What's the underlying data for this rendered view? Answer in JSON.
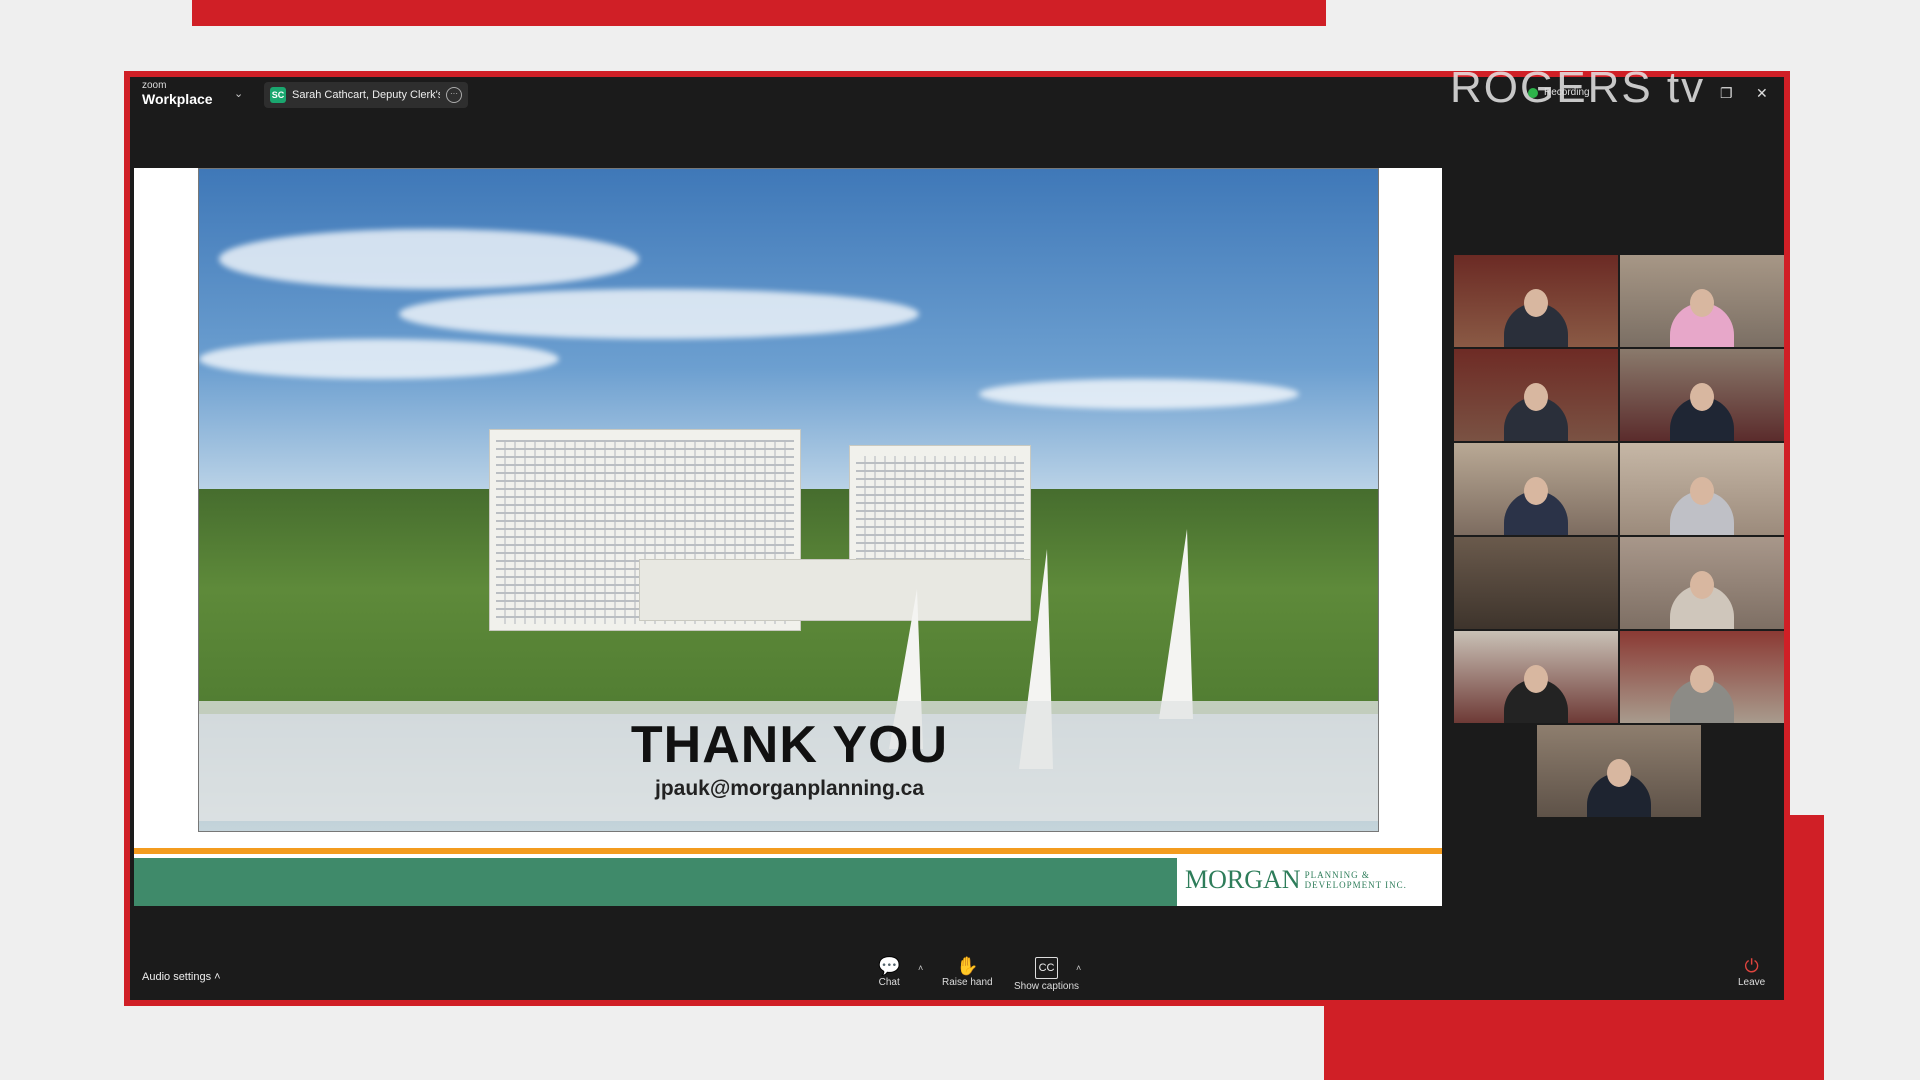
{
  "window": {
    "app_logo_small": "zoom",
    "app_logo_big": "Workplace",
    "share_badge": "SC",
    "share_label": "Sarah Cathcart, Deputy Clerk's sc",
    "broadcaster": "ROGERS tv",
    "recording_label": "Recording"
  },
  "slide": {
    "title": "THANK YOU",
    "email": "jpauk@morganplanning.ca",
    "logo_name": "MORGAN",
    "logo_sub_line1": "Planning &",
    "logo_sub_line2": "Development Inc."
  },
  "toolbar": {
    "audio_settings": "Audio settings",
    "chat": "Chat",
    "raise_hand": "Raise hand",
    "show_captions": "Show captions",
    "leave": "Leave"
  },
  "colors": {
    "broadcast_red": "#d01f26",
    "zoom_bg": "#1b1b1b",
    "slide_green": "#3f8a6a",
    "slide_orange": "#f39c1f",
    "active_speaker": "#3ad26a"
  }
}
